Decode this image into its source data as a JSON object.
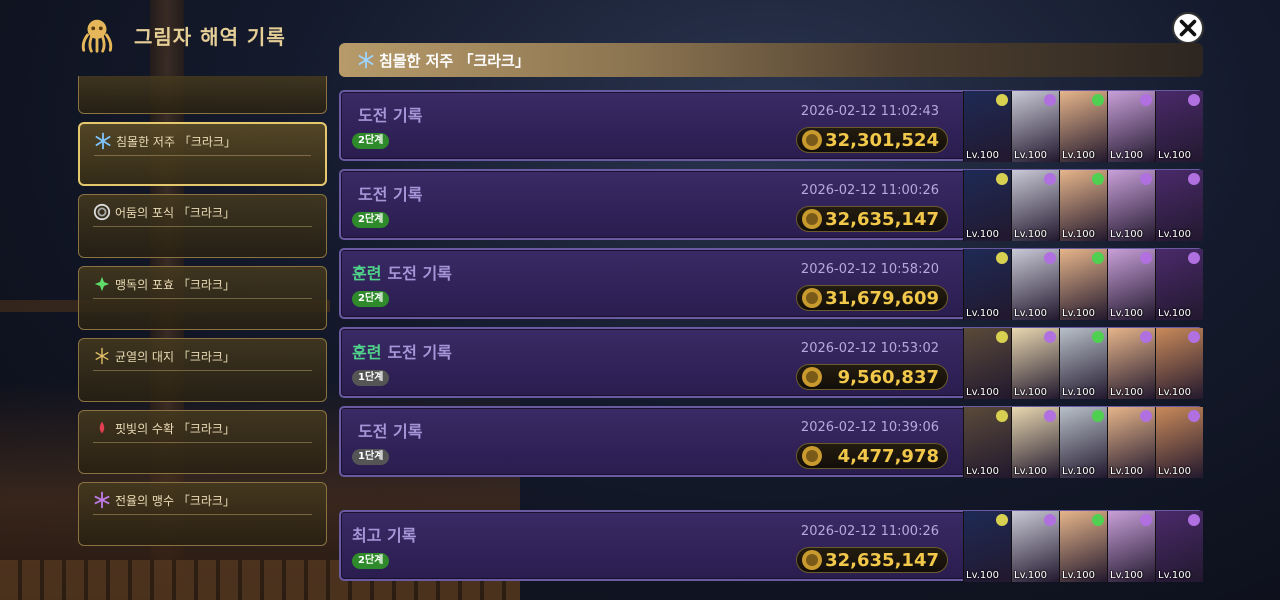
{
  "header": {
    "title": "그림자 해역 기록",
    "icon": "octopus-icon"
  },
  "close": {
    "icon": "close-icon"
  },
  "sidebar": {
    "items": [
      {
        "label": "",
        "icon": ""
      },
      {
        "label": "침몰한 저주 「크라크」",
        "icon": "snowflake-icon",
        "active": true
      },
      {
        "label": "어둠의 포식 「크라크」",
        "icon": "vortex-icon"
      },
      {
        "label": "맹독의 포효 「크라크」",
        "icon": "leaf-icon"
      },
      {
        "label": "균열의 대지 「크라크」",
        "icon": "earth-icon"
      },
      {
        "label": "핏빛의 수확 「크라크」",
        "icon": "blood-icon"
      },
      {
        "label": "전율의 맹수 「크라크」",
        "icon": "lightning-icon"
      }
    ]
  },
  "topbar": {
    "label": "침몰한 저주 「크라크」",
    "icon": "snowflake-icon"
  },
  "records": [
    {
      "train": "",
      "title": "도전 기록",
      "stage": "2단계",
      "date": "2026-02-12 11:02:43",
      "score": "32,301,524"
    },
    {
      "train": "",
      "title": "도전 기록",
      "stage": "2단계",
      "date": "2026-02-12 11:00:26",
      "score": "32,635,147"
    },
    {
      "train": "훈련",
      "title": "도전 기록",
      "stage": "2단계",
      "date": "2026-02-12 10:58:20",
      "score": "31,679,609"
    },
    {
      "train": "훈련",
      "title": "도전 기록",
      "stage": "1단계",
      "date": "2026-02-12 10:53:02",
      "score": "9,560,837"
    },
    {
      "train": "",
      "title": "도전 기록",
      "stage": "1단계",
      "date": "2026-02-12 10:39:06",
      "score": "4,477,978"
    }
  ],
  "best": {
    "title": "최고 기록",
    "stage": "2단계",
    "date": "2026-02-12 11:00:26",
    "score": "32,635,147"
  },
  "hero_level": "Lv.100",
  "colors": {
    "accent": "#e6cf97",
    "card": "#2a1d4e",
    "score": "#f2c84b",
    "train": "#4fd48a"
  }
}
